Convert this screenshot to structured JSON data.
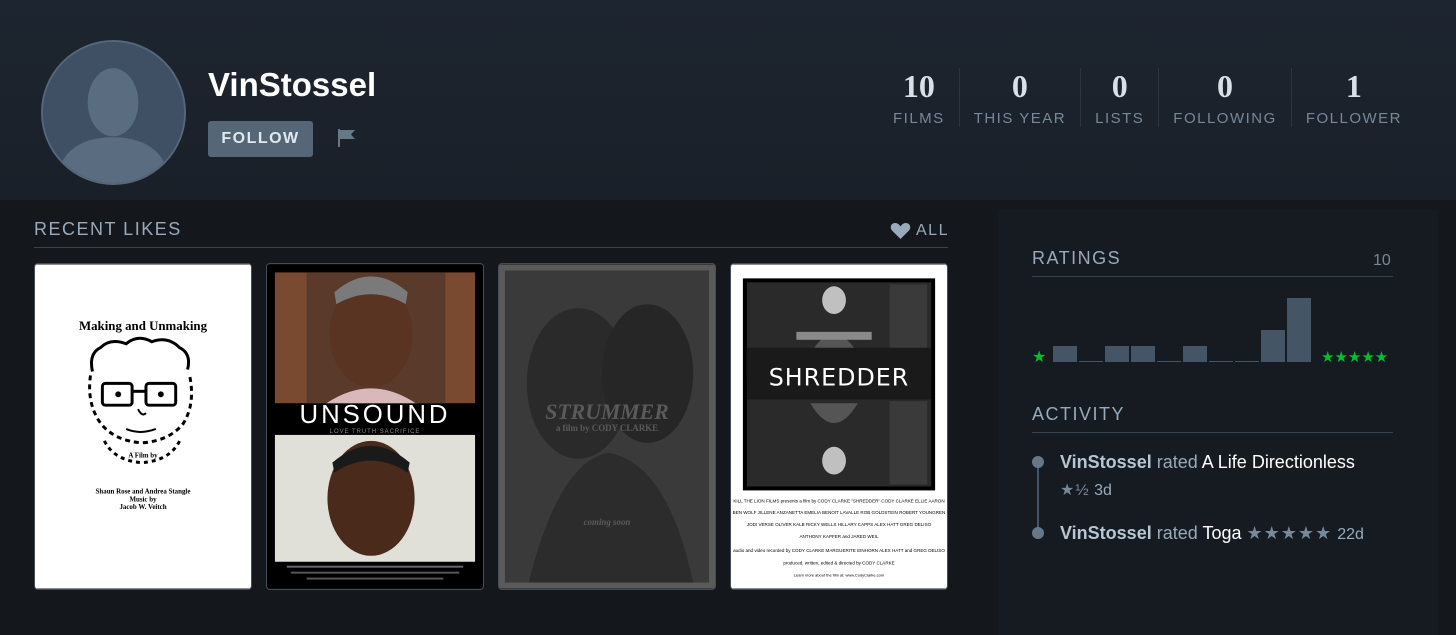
{
  "profile": {
    "username": "VinStossel",
    "follow_label": "FOLLOW",
    "stats": [
      {
        "value": "10",
        "label": "FILMS"
      },
      {
        "value": "0",
        "label": "THIS YEAR"
      },
      {
        "value": "0",
        "label": "LISTS"
      },
      {
        "value": "0",
        "label": "FOLLOWING"
      },
      {
        "value": "1",
        "label": "FOLLOWER"
      }
    ]
  },
  "recent_likes": {
    "title": "RECENT LIKES",
    "all_label": "ALL",
    "posters": [
      {
        "title": "Making and Unmaking",
        "credits": [
          "A Film by",
          "Shaun Rose and Andrea Stangle",
          "Music by",
          "Jacob W. Veitch"
        ]
      },
      {
        "title": "UNSOUND",
        "tagline": "LOVE   TRUTH   SACRIFICE"
      },
      {
        "title": "STRUMMER",
        "subtitle": "a film by CODY CLARKE",
        "note": "coming soon"
      },
      {
        "title": "SHREDDER",
        "credits": [
          "KILL THE LION FILMS  presents a film by  CODY CLARKE  \"SHREDDER\"  CODY CLARKE  ELLIE AARON",
          "BEN WOLF  JILLENE ANZANETTA  EMELIA BENOIT LAVALLE  ROB GOLDSTEIN  ROBERT YOUNGREN",
          "JODI VERSE  OLIVER KALB  RICKY WELLS  HILLARY CAPPS  ALEX HATT  GREG DELISO",
          "ANTHONY KAPFER  and  JARED WEIL",
          "audio and video recorded by  CODY CLARKE  MARGUERITE EINHORN  ALEX HATT  and  GREG DELISO",
          "produced, written, edited & directed by  CODY CLARKE",
          "Learn more about the film at: www.CodyClarke.com"
        ]
      }
    ]
  },
  "ratings": {
    "title": "RATINGS",
    "count": "10",
    "low_star": "★",
    "high_stars": "★★★★★",
    "star_color": "#00c030",
    "histogram": [
      1,
      0,
      1,
      1,
      0,
      1,
      0,
      0,
      2,
      4
    ]
  },
  "activity": {
    "title": "ACTIVITY",
    "items": [
      {
        "user": "VinStossel",
        "verb": "rated",
        "film": "A Life Directionless",
        "stars": "★½",
        "time": "3d"
      },
      {
        "user": "VinStossel",
        "verb": "rated",
        "film": "Toga",
        "stars": "★★★★★",
        "time": "22d"
      }
    ]
  }
}
